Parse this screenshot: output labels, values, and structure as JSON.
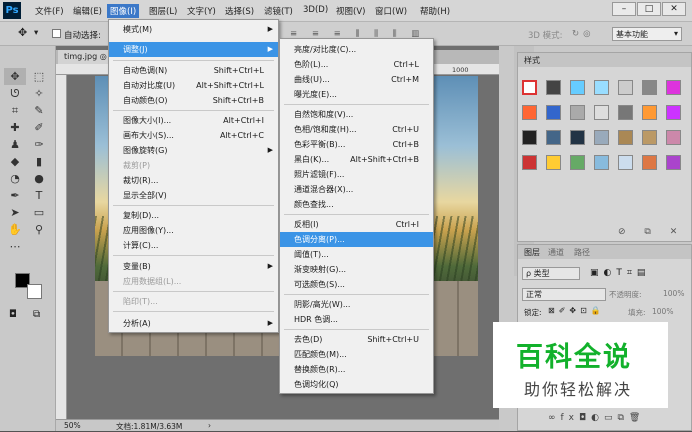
{
  "app": {
    "logo": "Ps"
  },
  "menubar": {
    "items": [
      "文件(F)",
      "编辑(E)",
      "图像(I)",
      "图层(L)",
      "文字(Y)",
      "选择(S)",
      "滤镜(T)",
      "3D(D)",
      "视图(V)",
      "窗口(W)",
      "帮助(H)"
    ],
    "active": "图像(I)",
    "window_controls": {
      "minimize": "–",
      "restore": "□",
      "close": "✕"
    }
  },
  "options": {
    "move_icon": "move-tool-icon",
    "auto_select_label": "自动选择:",
    "mode_3d_label": "3D 模式:",
    "workspace": "基本功能"
  },
  "document": {
    "tab": "timg.jpg ◎",
    "ruler_mark": "1000",
    "status": "50%",
    "file_info": "文档:1.81M/3.63M"
  },
  "image_menu": {
    "items": [
      {
        "label": "模式(M)",
        "submenu": true
      },
      {
        "label": "调整(J)",
        "submenu": true,
        "highlight": true
      },
      {
        "label": "自动色调(N)",
        "shortcut": "Shift+Ctrl+L"
      },
      {
        "label": "自动对比度(U)",
        "shortcut": "Alt+Shift+Ctrl+L"
      },
      {
        "label": "自动颜色(O)",
        "shortcut": "Shift+Ctrl+B"
      },
      {
        "label": "图像大小(I)...",
        "shortcut": "Alt+Ctrl+I"
      },
      {
        "label": "画布大小(S)...",
        "shortcut": "Alt+Ctrl+C"
      },
      {
        "label": "图像旋转(G)",
        "submenu": true
      },
      {
        "label": "裁剪(P)",
        "disabled": true
      },
      {
        "label": "裁切(R)..."
      },
      {
        "label": "显示全部(V)"
      },
      {
        "label": "复制(D)..."
      },
      {
        "label": "应用图像(Y)..."
      },
      {
        "label": "计算(C)..."
      },
      {
        "label": "变量(B)",
        "submenu": true
      },
      {
        "label": "应用数据组(L)...",
        "disabled": true
      },
      {
        "label": "陷印(T)...",
        "disabled": true
      },
      {
        "label": "分析(A)",
        "submenu": true
      }
    ]
  },
  "adjust_menu": {
    "items": [
      {
        "label": "亮度/对比度(C)..."
      },
      {
        "label": "色阶(L)...",
        "shortcut": "Ctrl+L"
      },
      {
        "label": "曲线(U)...",
        "shortcut": "Ctrl+M"
      },
      {
        "label": "曝光度(E)..."
      },
      {
        "label": "自然饱和度(V)..."
      },
      {
        "label": "色相/饱和度(H)...",
        "shortcut": "Ctrl+U"
      },
      {
        "label": "色彩平衡(B)...",
        "shortcut": "Ctrl+B"
      },
      {
        "label": "黑白(K)...",
        "shortcut": "Alt+Shift+Ctrl+B"
      },
      {
        "label": "照片滤镜(F)..."
      },
      {
        "label": "通道混合器(X)..."
      },
      {
        "label": "颜色查找..."
      },
      {
        "label": "反相(I)",
        "shortcut": "Ctrl+I"
      },
      {
        "label": "色调分离(P)...",
        "highlight": true
      },
      {
        "label": "阈值(T)..."
      },
      {
        "label": "渐变映射(G)..."
      },
      {
        "label": "可选颜色(S)..."
      },
      {
        "label": "阴影/高光(W)..."
      },
      {
        "label": "HDR 色调..."
      },
      {
        "label": "去色(D)",
        "shortcut": "Shift+Ctrl+U"
      },
      {
        "label": "匹配颜色(M)..."
      },
      {
        "label": "替换颜色(R)..."
      },
      {
        "label": "色调均化(Q)"
      }
    ]
  },
  "panels": {
    "styles_tab": "样式",
    "layers_tabs": [
      "图层",
      "通道",
      "路径"
    ],
    "kind_filter": "ρ 类型",
    "blend_mode": "正常",
    "opacity_label": "不透明度:",
    "opacity_value": "100%",
    "lock_label": "锁定:",
    "fill_label": "填充:",
    "fill_value": "100%"
  },
  "watermark": {
    "title": "百科全说",
    "subtitle": "助你轻松解决"
  }
}
